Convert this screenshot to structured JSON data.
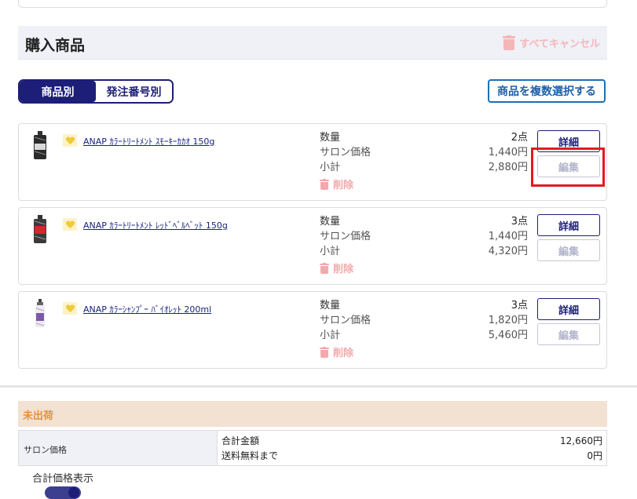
{
  "section": {
    "title": "購入商品",
    "cancel_all": "すべてキャンセル"
  },
  "segment": {
    "tabs": [
      {
        "label": "商品別",
        "active": true
      },
      {
        "label": "発注番号別",
        "active": false
      }
    ]
  },
  "multi_select_label": "商品を複数選択する",
  "labels": {
    "quantity": "数量",
    "salon_price": "サロン価格",
    "subtotal": "小計",
    "delete": "削除",
    "detail": "詳細",
    "edit": "編集"
  },
  "items": [
    {
      "name": "ANAP ｶﾗｰﾄﾘｰﾄﾒﾝﾄ ｽﾓｰｷｰｶｶｵ 150g",
      "qty": "2点",
      "price": "1,440円",
      "subtotal": "2,880円",
      "thumb": "dark"
    },
    {
      "name": "ANAP ｶﾗｰﾄﾘｰﾄﾒﾝﾄ ﾚｯﾄﾞﾍﾞﾙﾍﾞｯﾄ 150g",
      "qty": "3点",
      "price": "1,440円",
      "subtotal": "4,320円",
      "thumb": "red"
    },
    {
      "name": "ANAP ｶﾗｰｼｬﾝﾌﾟｰ ﾊﾞｲｵﾚｯﾄ 200ml",
      "qty": "3点",
      "price": "1,820円",
      "subtotal": "5,460円",
      "thumb": "violet"
    }
  ],
  "summary": {
    "status": "未出荷",
    "row_label": "サロン価格",
    "total_label": "合計金額",
    "total_value": "12,660円",
    "free_shipping_label": "送料無料まで",
    "free_shipping_value": "0円"
  },
  "toggle": {
    "label": "合計価格表示",
    "on": true
  },
  "colors": {
    "primary": "#1c1e77",
    "accent_blue": "#1e6fb3",
    "danger_soft": "#f4b7b9",
    "highlight": "#e21a22",
    "unshipped_bg": "#f3e1d1",
    "unshipped_text": "#e2923c"
  }
}
